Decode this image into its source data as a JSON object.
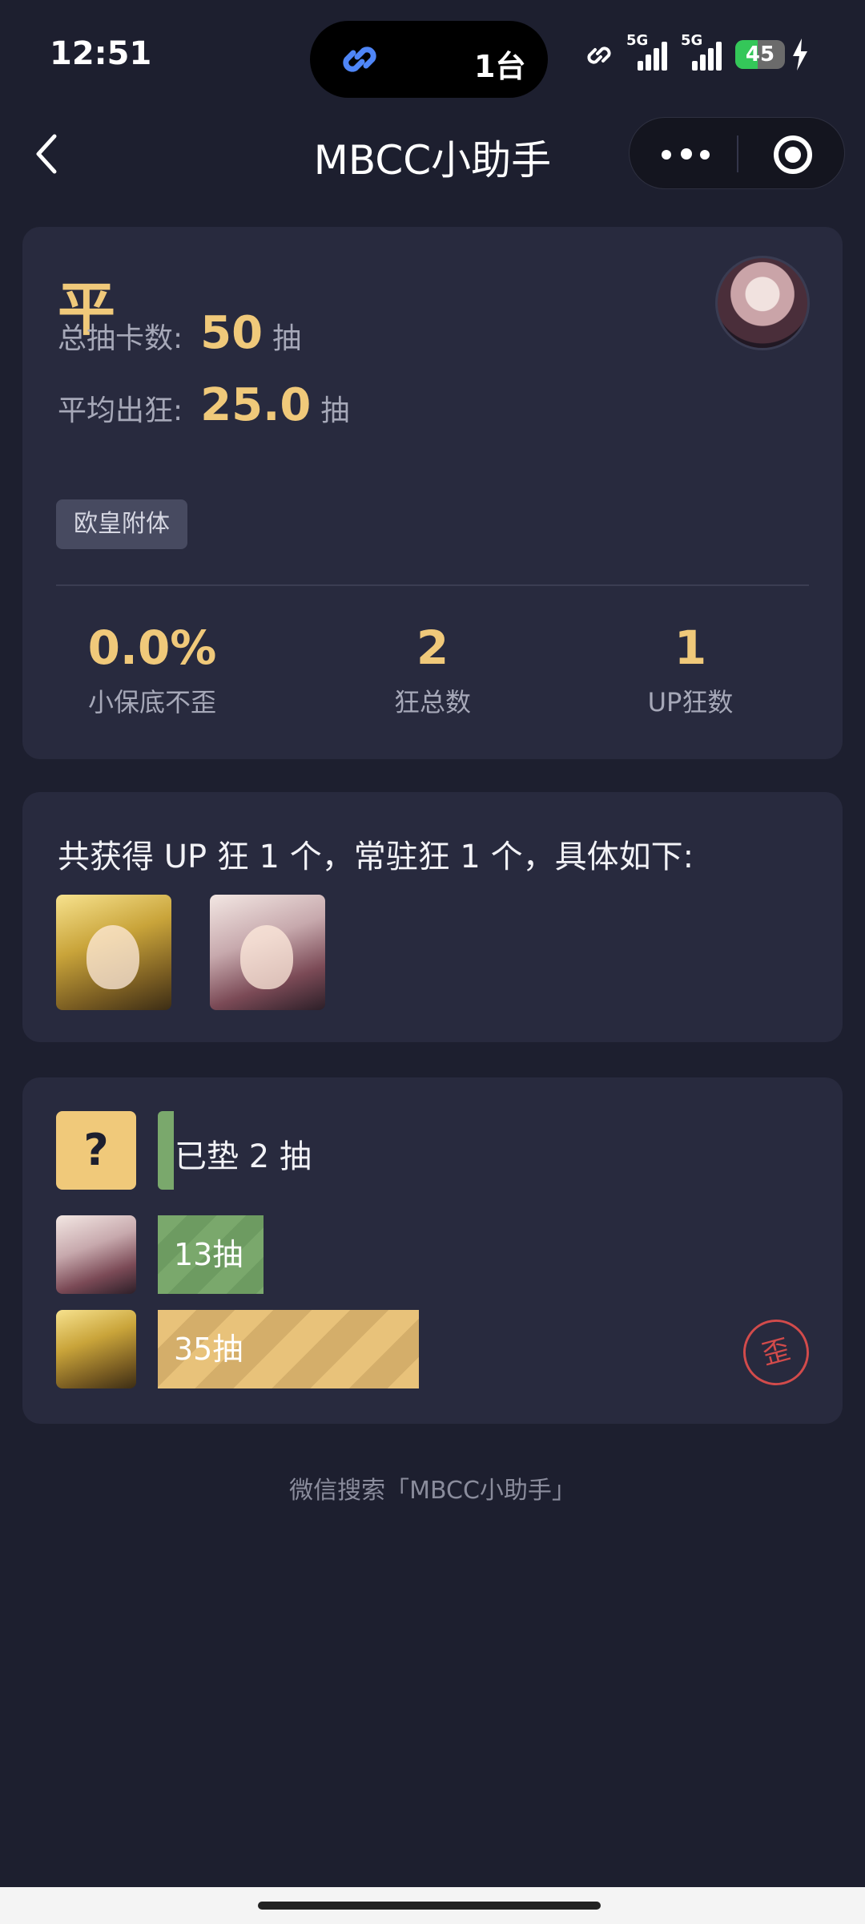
{
  "status": {
    "time": "12:51",
    "island_text": "1台",
    "sim1": "5G",
    "sim2": "5G",
    "battery": "45",
    "battery_level": 0.45
  },
  "nav": {
    "title": "MBCC小助手"
  },
  "summary": {
    "rating": "平",
    "total_label": "总抽卡数:",
    "total_value": "50",
    "total_unit": "抽",
    "avg_label": "平均出狂:",
    "avg_value": "25.0",
    "avg_unit": "抽",
    "tag": "欧皇附体",
    "metrics": [
      {
        "value": "0.0%",
        "label": "小保底不歪"
      },
      {
        "value": "2",
        "label": "狂总数"
      },
      {
        "value": "1",
        "label": "UP狂数"
      }
    ]
  },
  "obtained": {
    "text": "共获得 UP 狂 1 个，常驻狂 1 个，具体如下:"
  },
  "history": {
    "pending_icon": "?",
    "pending_label": "已垫 2 抽",
    "rows": [
      {
        "label": "13抽",
        "pulls": 13
      },
      {
        "label": "35抽",
        "pulls": 35,
        "stamp": "歪"
      }
    ]
  },
  "footer": {
    "text": "微信搜索「MBCC小助手」"
  },
  "colors": {
    "background": "#1d1f2f",
    "card": "#282a3e",
    "gold": "#f0c97a",
    "green": "#7aa86c",
    "stamp_red": "#d24b4b"
  }
}
